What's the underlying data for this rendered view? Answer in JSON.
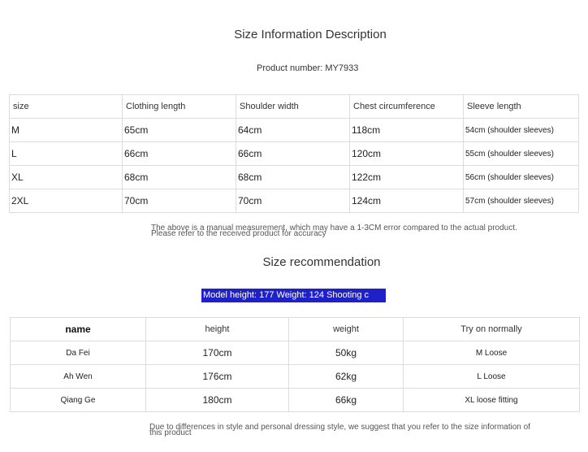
{
  "title": "Size Information Description",
  "product_number": "Product number: MY7933",
  "size_table": {
    "headers": [
      "size",
      "Clothing length",
      "Shoulder width",
      "Chest circumference",
      "Sleeve length"
    ],
    "rows": [
      [
        "M",
        "65cm",
        "64cm",
        "118cm",
        "54cm (shoulder sleeves)"
      ],
      [
        "L",
        "66cm",
        "66cm",
        "120cm",
        "55cm (shoulder sleeves)"
      ],
      [
        "XL",
        "68cm",
        "68cm",
        "122cm",
        "56cm (shoulder sleeves)"
      ],
      [
        "2XL",
        "70cm",
        "70cm",
        "124cm",
        "57cm (shoulder sleeves)"
      ]
    ]
  },
  "note1": {
    "line1": "The above is a manual measurement, which may have a 1-3CM error compared to the actual product.",
    "line2": "Please refer to the received product for accuracy"
  },
  "recommendation_title": "Size recommendation",
  "model_info": "Model height: 177 Weight: 124 Shooting c",
  "rec_table": {
    "headers": [
      "name",
      "height",
      "weight",
      "Try on normally"
    ],
    "rows": [
      [
        "Da Fei",
        "170cm",
        "50kg",
        "M Loose"
      ],
      [
        "Ah Wen",
        "176cm",
        "62kg",
        "L Loose"
      ],
      [
        "Qiang Ge",
        "180cm",
        "66kg",
        "XL loose fitting"
      ]
    ]
  },
  "note2": {
    "line1": "Due to differences in style and personal dressing style, we suggest that you refer to the size information of",
    "line2": "this product"
  }
}
